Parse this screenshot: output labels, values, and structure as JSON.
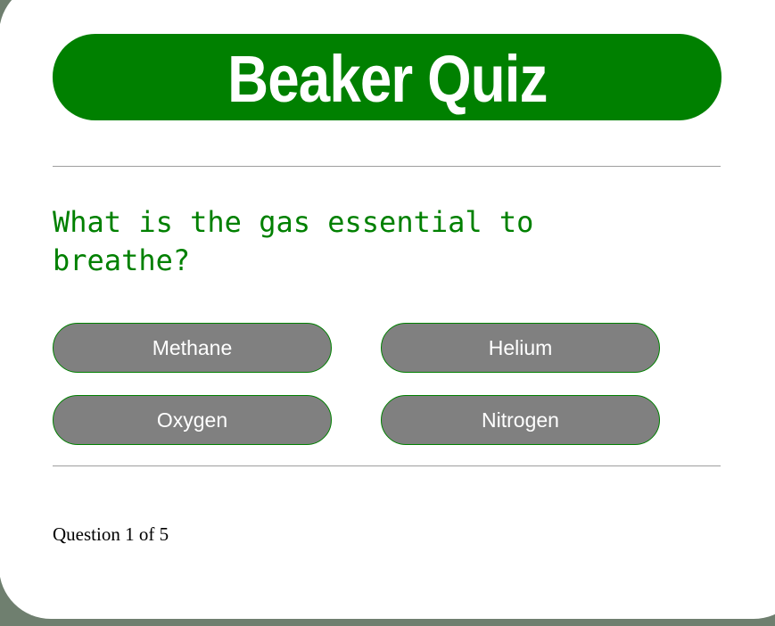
{
  "header": {
    "title": "Beaker Quiz"
  },
  "quiz": {
    "question": "What is the gas essential to breathe?",
    "answers": [
      "Methane",
      "Helium",
      "Oxygen",
      "Nitrogen"
    ],
    "progress": "Question 1 of 5"
  },
  "colors": {
    "accent": "#008000",
    "button_bg": "#808080",
    "button_text": "#ffffff",
    "background_frame": "#6f7f6f"
  }
}
